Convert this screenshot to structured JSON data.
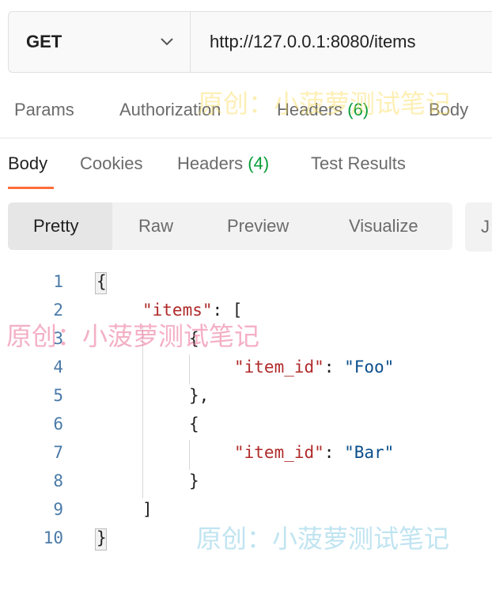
{
  "request": {
    "method": "GET",
    "url": "http://127.0.0.1:8080/items"
  },
  "request_tabs": {
    "params": "Params",
    "authorization": "Authorization",
    "headers": "Headers",
    "headers_count": "(6)",
    "body": "Body"
  },
  "response_tabs": {
    "body": "Body",
    "cookies": "Cookies",
    "headers": "Headers",
    "headers_count": "(4)",
    "test_results": "Test Results"
  },
  "view_modes": {
    "pretty": "Pretty",
    "raw": "Raw",
    "preview": "Preview",
    "visualize": "Visualize",
    "format": "J"
  },
  "code": {
    "line_numbers": [
      "1",
      "2",
      "3",
      "4",
      "5",
      "6",
      "7",
      "8",
      "9",
      "10"
    ],
    "open_brace": "{",
    "items_key": "\"items\"",
    "colon_bracket": ": [",
    "obj_open": "{",
    "item_id_key": "\"item_id\"",
    "colon": ": ",
    "value_foo": "\"Foo\"",
    "obj_close_comma": "},",
    "value_bar": "\"Bar\"",
    "obj_close": "}",
    "array_close": "]",
    "close_brace": "}"
  },
  "watermark": "原创：小菠萝测试笔记",
  "colors": {
    "accent": "#ff6c37",
    "count_green": "#0a9d3a",
    "json_key": "#b02a2a",
    "json_string": "#0b4e8a"
  }
}
